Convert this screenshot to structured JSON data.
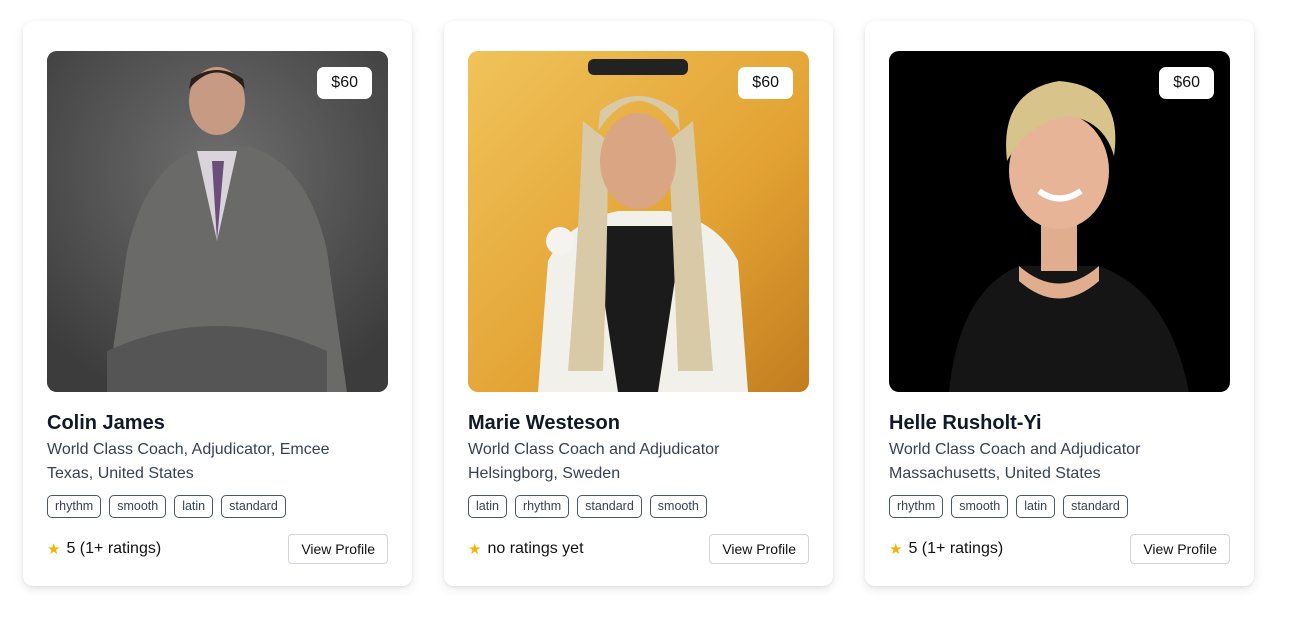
{
  "coaches": [
    {
      "price": "$60",
      "name": "Colin James",
      "title": "World Class Coach, Adjudicator, Emcee",
      "location": "Texas, United States",
      "tags": [
        "rhythm",
        "smooth",
        "latin",
        "standard"
      ],
      "rating": "5 (1+ ratings)",
      "button": "View Profile"
    },
    {
      "price": "$60",
      "name": "Marie Westeson",
      "title": "World Class Coach and Adjudicator",
      "location": "Helsingborg, Sweden",
      "tags": [
        "latin",
        "rhythm",
        "standard",
        "smooth"
      ],
      "rating": "no ratings yet",
      "button": "View Profile"
    },
    {
      "price": "$60",
      "name": "Helle Rusholt-Yi",
      "title": "World Class Coach and Adjudicator",
      "location": "Massachusetts, United States",
      "tags": [
        "rhythm",
        "smooth",
        "latin",
        "standard"
      ],
      "rating": "5 (1+ ratings)",
      "button": "View Profile"
    }
  ],
  "colors": {
    "star": "#f5b301",
    "text": "#111827"
  },
  "icons": {
    "rating": "star-icon"
  }
}
